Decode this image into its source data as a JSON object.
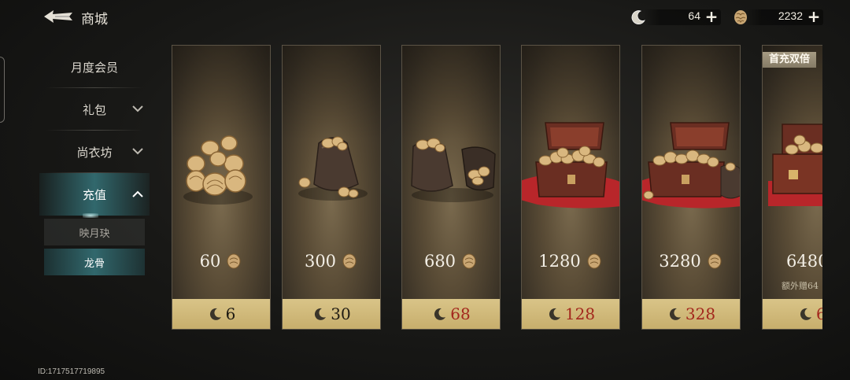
{
  "header": {
    "title": "商城",
    "back_icon": "back-arrow-icon"
  },
  "currencies": [
    {
      "name": "jade",
      "icon": "jade-crescent-icon",
      "value": "64"
    },
    {
      "name": "walnut",
      "icon": "walnut-icon",
      "value": "2232"
    }
  ],
  "sidebar": {
    "items": [
      {
        "label": "月度会员"
      },
      {
        "label": "礼包"
      },
      {
        "label": "尚衣坊"
      },
      {
        "label": "充值"
      }
    ],
    "sub_items": [
      {
        "label": "映月玦"
      },
      {
        "label": "龙骨"
      }
    ]
  },
  "footer": {
    "uid": "ID:1717517719895"
  },
  "products": [
    {
      "amount": "60",
      "price": "6",
      "price_color": "#1e1a12"
    },
    {
      "amount": "300",
      "price": "30",
      "price_color": "#1e1a12"
    },
    {
      "amount": "680",
      "price": "68",
      "price_color": "#a3271d"
    },
    {
      "amount": "1280",
      "price": "128",
      "price_color": "#a3271d"
    },
    {
      "amount": "3280",
      "price": "328",
      "price_color": "#a3271d"
    },
    {
      "amount": "6480",
      "price": "6",
      "price_color": "#a3271d",
      "badge": "首充双倍",
      "bonus": "额外赠64"
    }
  ],
  "colors": {
    "accent_teal": "#36767c",
    "price_bar": "#d9c488",
    "discount_red": "#a3271d"
  }
}
